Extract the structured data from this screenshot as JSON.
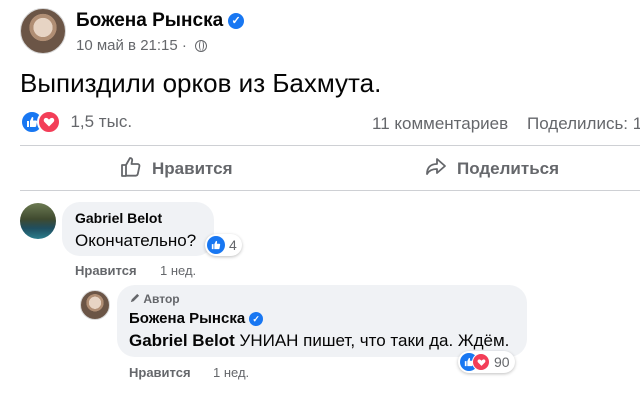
{
  "post": {
    "author": "Божена Рынска",
    "date": "10 май в 21:15",
    "separator": "·",
    "text": "Выпиздили орков из Бахмута.",
    "reaction_count": "1,5 тыс.",
    "comments_count": "11 комментариев",
    "shares_count": "Поделились: 1"
  },
  "actions": {
    "like_label": "Нравится",
    "share_label": "Поделиться"
  },
  "comment": {
    "author": "Gabriel Belot",
    "text": "Окончательно?",
    "reaction_count": "4",
    "like_label": "Нравится",
    "time": "1 нед."
  },
  "reply": {
    "badge": "Автор",
    "author": "Божена Рынска",
    "mention": "Gabriel Belot",
    "text": "УНИАН пишет, что таки да. Ждём.",
    "reaction_count": "90",
    "like_label": "Нравится",
    "time": "1 нед."
  },
  "colors": {
    "accent": "#1877f2",
    "love": "#f33e58",
    "secondary_text": "#65676b",
    "bubble_bg": "#f0f2f5"
  },
  "icons": [
    "verified-icon",
    "globe-icon",
    "more-icon",
    "like-reaction-icon",
    "love-reaction-icon",
    "thumbs-up-icon",
    "share-arrow-icon",
    "pencil-icon"
  ]
}
